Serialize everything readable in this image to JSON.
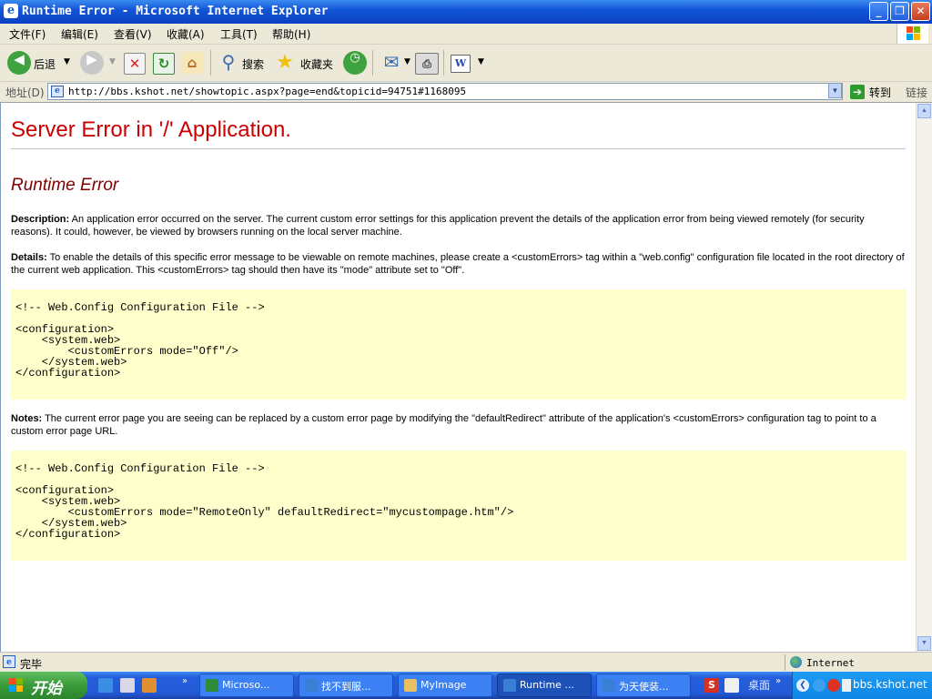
{
  "window": {
    "title": "Runtime Error - Microsoft Internet Explorer",
    "minimize_glyph": "_",
    "maximize_glyph": "❐",
    "close_glyph": "✕"
  },
  "menu": {
    "items": [
      "文件(F)",
      "编辑(E)",
      "查看(V)",
      "收藏(A)",
      "工具(T)",
      "帮助(H)"
    ]
  },
  "toolbar": {
    "back_label": "后退",
    "search_label": "搜索",
    "favorites_label": "收藏夹"
  },
  "address": {
    "label": "地址(D)",
    "url": "http://bbs.kshot.net/showtopic.aspx?page=end&topicid=94751#1168095",
    "go_label": "转到",
    "links_label": "链接"
  },
  "page": {
    "heading": "Server Error in '/' Application.",
    "subheading": "Runtime Error",
    "description_label": "Description:",
    "description_text": " An application error occurred on the server. The current custom error settings for this application prevent the details of the application error from being viewed remotely (for security reasons). It could, however, be viewed by browsers running on the local server machine.",
    "details_label": "Details:",
    "details_text": " To enable the details of this specific error message to be viewable on remote machines, please create a <customErrors> tag within a \"web.config\" configuration file located in the root directory of the current web application. This <customErrors> tag should then have its \"mode\" attribute set to \"Off\".",
    "code1": [
      "<!-- Web.Config Configuration File -->",
      "",
      "<configuration>",
      "    <system.web>",
      "        <customErrors mode=\"Off\"/>",
      "    </system.web>",
      "</configuration>"
    ],
    "notes_label": "Notes:",
    "notes_text": " The current error page you are seeing can be replaced by a custom error page by modifying the \"defaultRedirect\" attribute of the application's <customErrors> configuration tag to point to a custom error page URL.",
    "code2": [
      "<!-- Web.Config Configuration File -->",
      "",
      "<configuration>",
      "    <system.web>",
      "        <customErrors mode=\"RemoteOnly\" defaultRedirect=\"mycustompage.htm\"/>",
      "    </system.web>",
      "</configuration>"
    ]
  },
  "status": {
    "text": "完毕",
    "zone": "Internet"
  },
  "taskbar": {
    "start_label": "开始",
    "tasks": [
      {
        "label": "Microso...",
        "icon_color": "#2e8b3a"
      },
      {
        "label": "找不到服...",
        "icon_color": "#3a7fd6"
      },
      {
        "label": "MyImage",
        "icon_color": "#e8c060"
      },
      {
        "label": "Runtime ...",
        "icon_color": "#3a7fd6"
      },
      {
        "label": "为天使装...",
        "icon_color": "#3a7fd6"
      }
    ],
    "desktop_label": "桌面",
    "tray_text": "bbs.kshot.net"
  },
  "colors": {
    "heading": "#cc0000",
    "subheading": "#800000",
    "code_bg": "#ffffcc"
  }
}
